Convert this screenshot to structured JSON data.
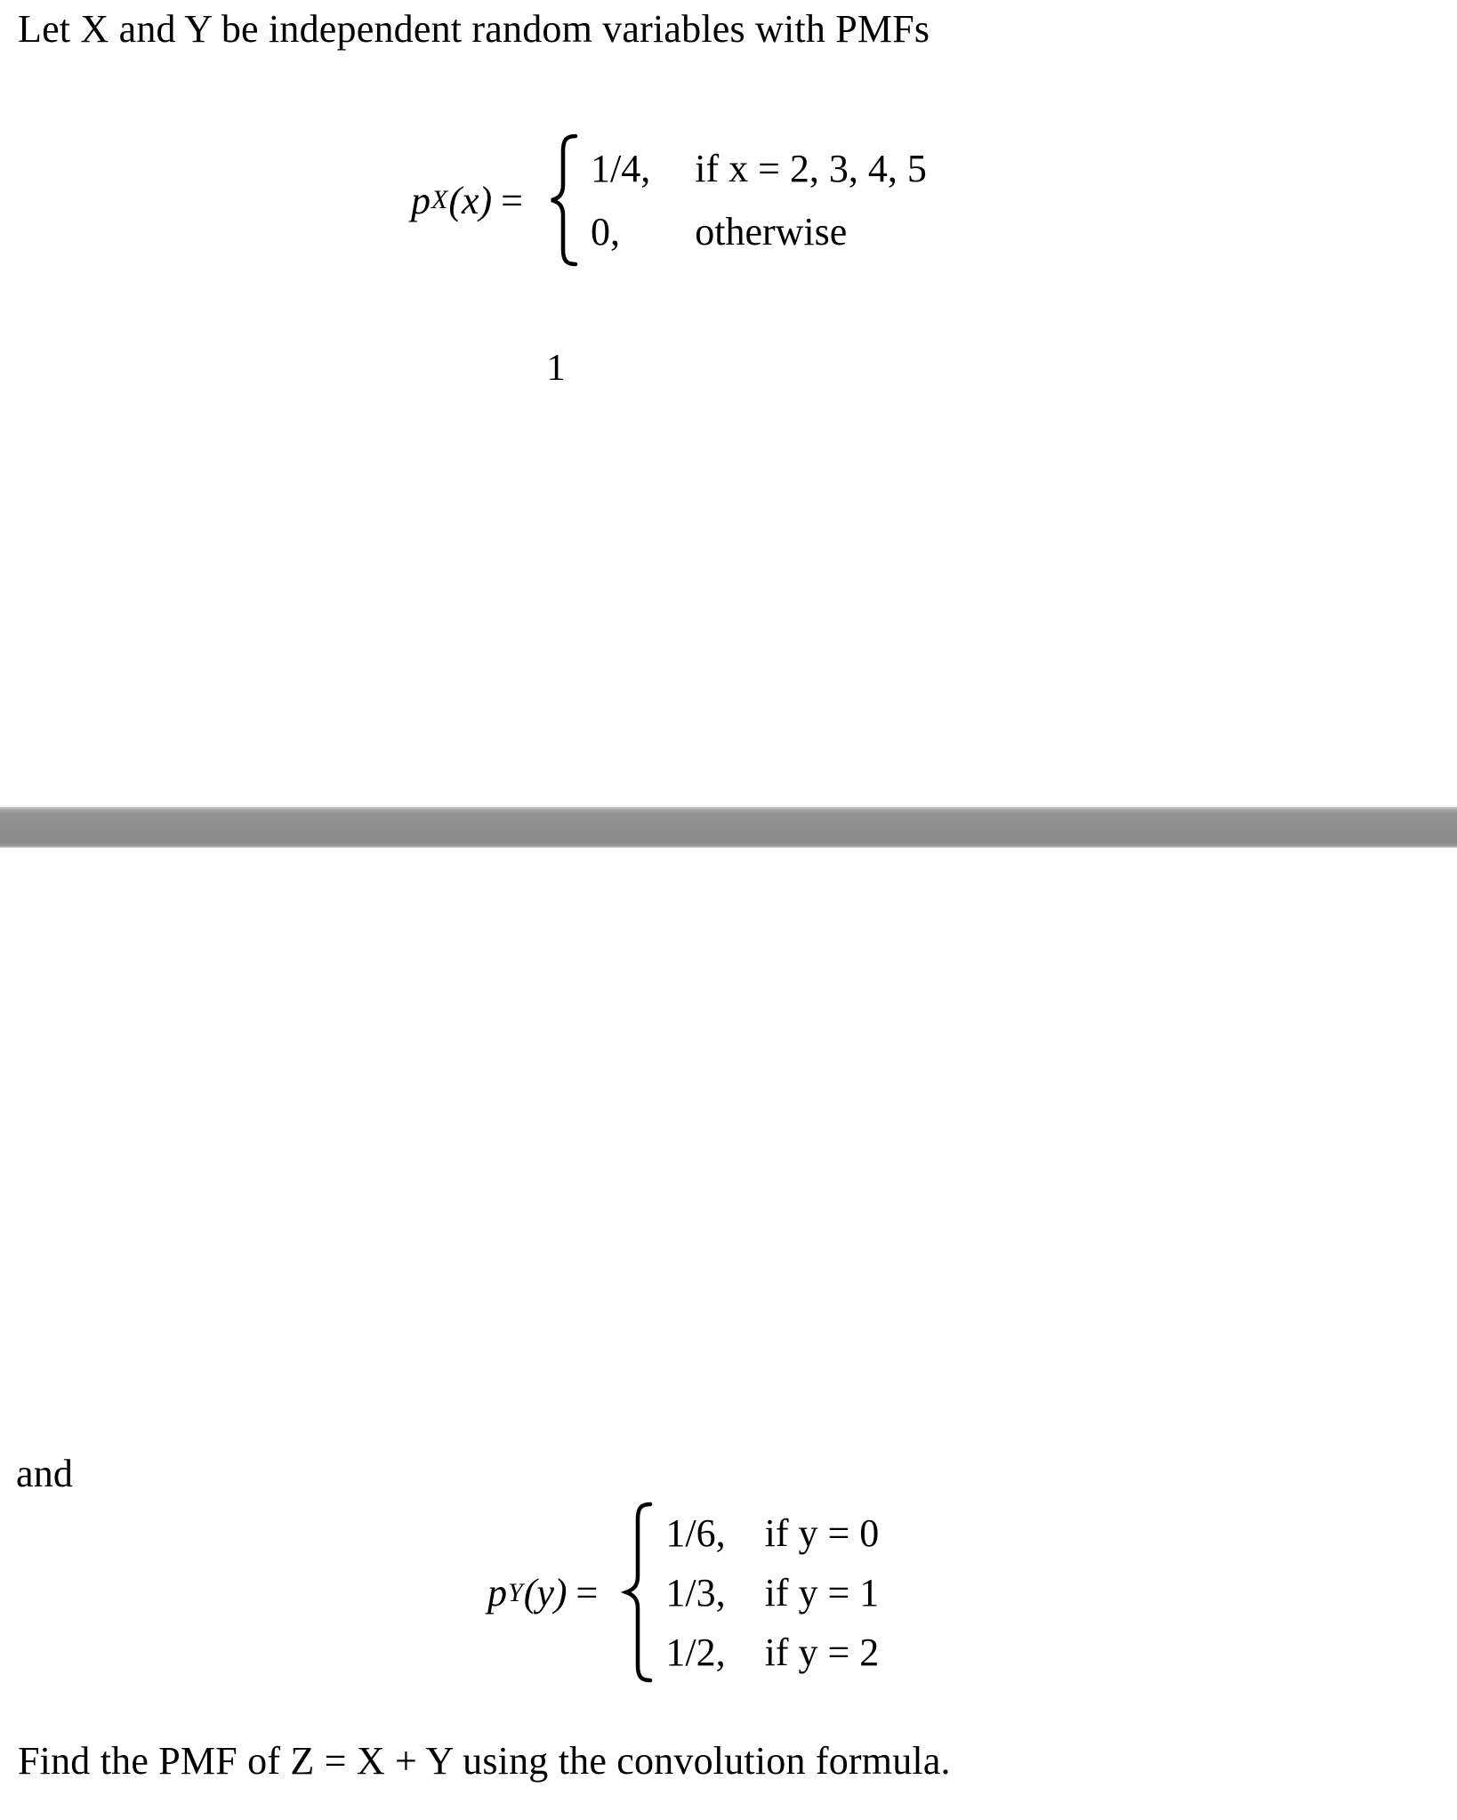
{
  "document": {
    "page_number": "1",
    "separator_color": "#8d8d8d",
    "text_color": "#000000",
    "background_color": "#ffffff"
  },
  "intro": {
    "text": "Let X and Y be independent random variables with PMFs"
  },
  "connector": {
    "text": "and"
  },
  "closing": {
    "text": "Find the PMF of Z = X + Y using the convolution formula."
  },
  "equations": {
    "px": {
      "function_name": "p",
      "subscript": "X",
      "argument": "(x)",
      "equals": "=",
      "cases": [
        {
          "value": "1/4,",
          "condition": "if x = 2, 3, 4, 5"
        },
        {
          "value": "0,",
          "condition": "otherwise"
        }
      ]
    },
    "py": {
      "function_name": "p",
      "subscript": "Y",
      "argument": "(y)",
      "equals": "=",
      "cases": [
        {
          "value": "1/6,",
          "condition": "if y = 0"
        },
        {
          "value": "1/3,",
          "condition": "if y = 1"
        },
        {
          "value": "1/2,",
          "condition": "if y = 2"
        }
      ]
    }
  }
}
